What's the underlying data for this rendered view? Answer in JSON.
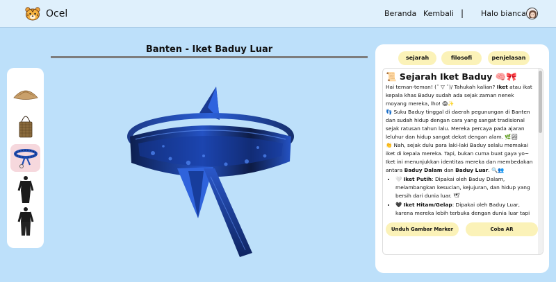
{
  "header": {
    "brand": "Ocel",
    "logo_icon": "tiger-face-icon",
    "nav": {
      "home": "Beranda",
      "back": "Kembali",
      "separator": "|",
      "greeting": "Halo bianca!"
    }
  },
  "page": {
    "title": "Banten - Iket Baduy Luar"
  },
  "items": [
    {
      "name": "Caping (topi anyaman)",
      "icon": "straw-hat-icon"
    },
    {
      "name": "Tas Koja",
      "icon": "woven-bag-icon"
    },
    {
      "name": "Iket Baduy Luar",
      "icon": "headband-icon",
      "active": true
    },
    {
      "name": "Baju hitam",
      "icon": "black-outfit-icon"
    },
    {
      "name": "Celana hitam",
      "icon": "black-outfit-pants-icon"
    }
  ],
  "panel": {
    "tabs": [
      "sejarah",
      "filosofi",
      "penjelasan"
    ],
    "section": {
      "title": "📜 Sejarah Iket Baduy 🧠🎀",
      "p1_pre": "Hai teman-teman! (ˆ ▽ ˆ)/ Tahukah kalian? ",
      "p1_bold": "Iket",
      "p1_post": " atau ikat kepala khas Baduy sudah ada sejak zaman nenek moyang mereka, lho! 😱✨",
      "p2": "👣 Suku Baduy tinggal di daerah pegunungan di Banten dan sudah hidup dengan cara yang sangat tradisional sejak ratusan tahun lalu. Mereka percaya pada ajaran leluhur dan hidup sangat dekat dengan alam. 🌿🏞",
      "p3_pre": "👏 Nah, sejak dulu para laki-laki Baduy selalu memakai iket di kepala mereka. Tapi, bukan cuma buat gaya yo~ Iket ini menunjukkan identitas mereka dan membedakan antara ",
      "p3_bold1": "Baduy Dalam",
      "p3_mid": " dan ",
      "p3_bold2": "Baduy Luar",
      "p3_post": ". 🔍👥",
      "li1_pre": "🤍 ",
      "li1_bold": "Iket Putih",
      "li1_post": ": Dipakai oleh Baduy Dalam, melambangkan kesucian, kejujuran, dan hidup yang bersih dari dunia luar. 🕊",
      "li2_pre": "🖤 ",
      "li2_bold": "Iket Hitam/Gelap",
      "li2_post": ": Dipakai oleh Baduy Luar, karena mereka lebih terbuka dengan dunia luar tapi"
    },
    "buttons": {
      "download": "Unduh Gambar Marker",
      "ar": "Coba AR"
    }
  }
}
